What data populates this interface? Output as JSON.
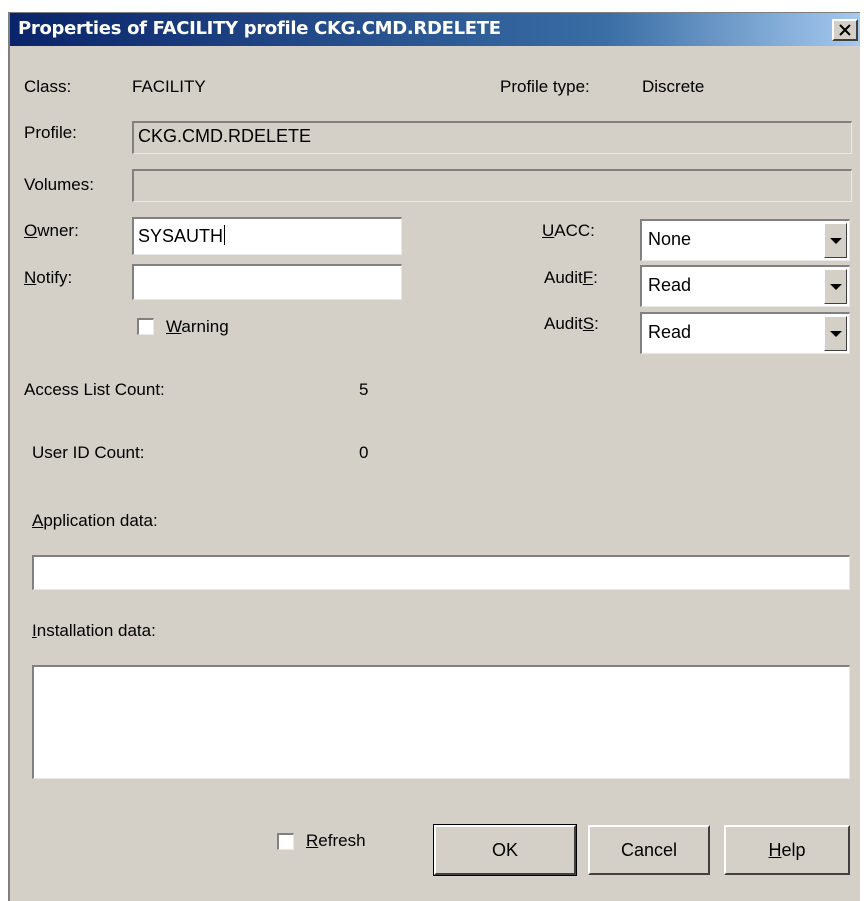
{
  "title": "Properties of FACILITY profile CKG.CMD.RDELETE",
  "fields": {
    "class_label": "Class:",
    "class_value": "FACILITY",
    "profile_type_label": "Profile type:",
    "profile_type_value": "Discrete",
    "profile_label": "Profile:",
    "profile_value": "CKG.CMD.RDELETE",
    "volumes_label": "Volumes:",
    "volumes_value": "",
    "owner_label_mnemonic": "O",
    "owner_label_rest": "wner:",
    "owner_value": "SYSAUTH",
    "notify_label_mnemonic": "N",
    "notify_label_rest": "otify:",
    "notify_value": "",
    "warning_mnemonic": "W",
    "warning_rest": "arning",
    "uacc_label_mnemonic": "U",
    "uacc_label_rest": "ACC:",
    "uacc_value": "None",
    "auditf_label_pre": "Audit",
    "auditf_label_mnemonic": "F",
    "auditf_label_post": ":",
    "auditf_value": "Read",
    "audits_label_pre": "Audit",
    "audits_label_mnemonic": "S",
    "audits_label_post": ":",
    "audits_value": "Read"
  },
  "counts": {
    "access_list_label": "Access List Count:",
    "access_list_value": "5",
    "user_id_label": "User ID Count:",
    "user_id_value": "0"
  },
  "application": {
    "label_mnemonic": "A",
    "label_rest": "pplication data:",
    "value": ""
  },
  "installation": {
    "label_mnemonic": "I",
    "label_rest": "nstallation data:",
    "value": ""
  },
  "footer": {
    "refresh_mnemonic": "R",
    "refresh_rest": "efresh",
    "ok_label": "OK",
    "cancel_label": "Cancel",
    "help_mnemonic": "H",
    "help_rest": "elp"
  },
  "colors": {
    "dialog_bg": "#d4d0c8",
    "title_start": "#0a246a",
    "title_end": "#a6caf0",
    "title_text": "#ffffff"
  },
  "icons": {
    "close": "close-icon",
    "dropdown": "chevron-down-icon"
  }
}
